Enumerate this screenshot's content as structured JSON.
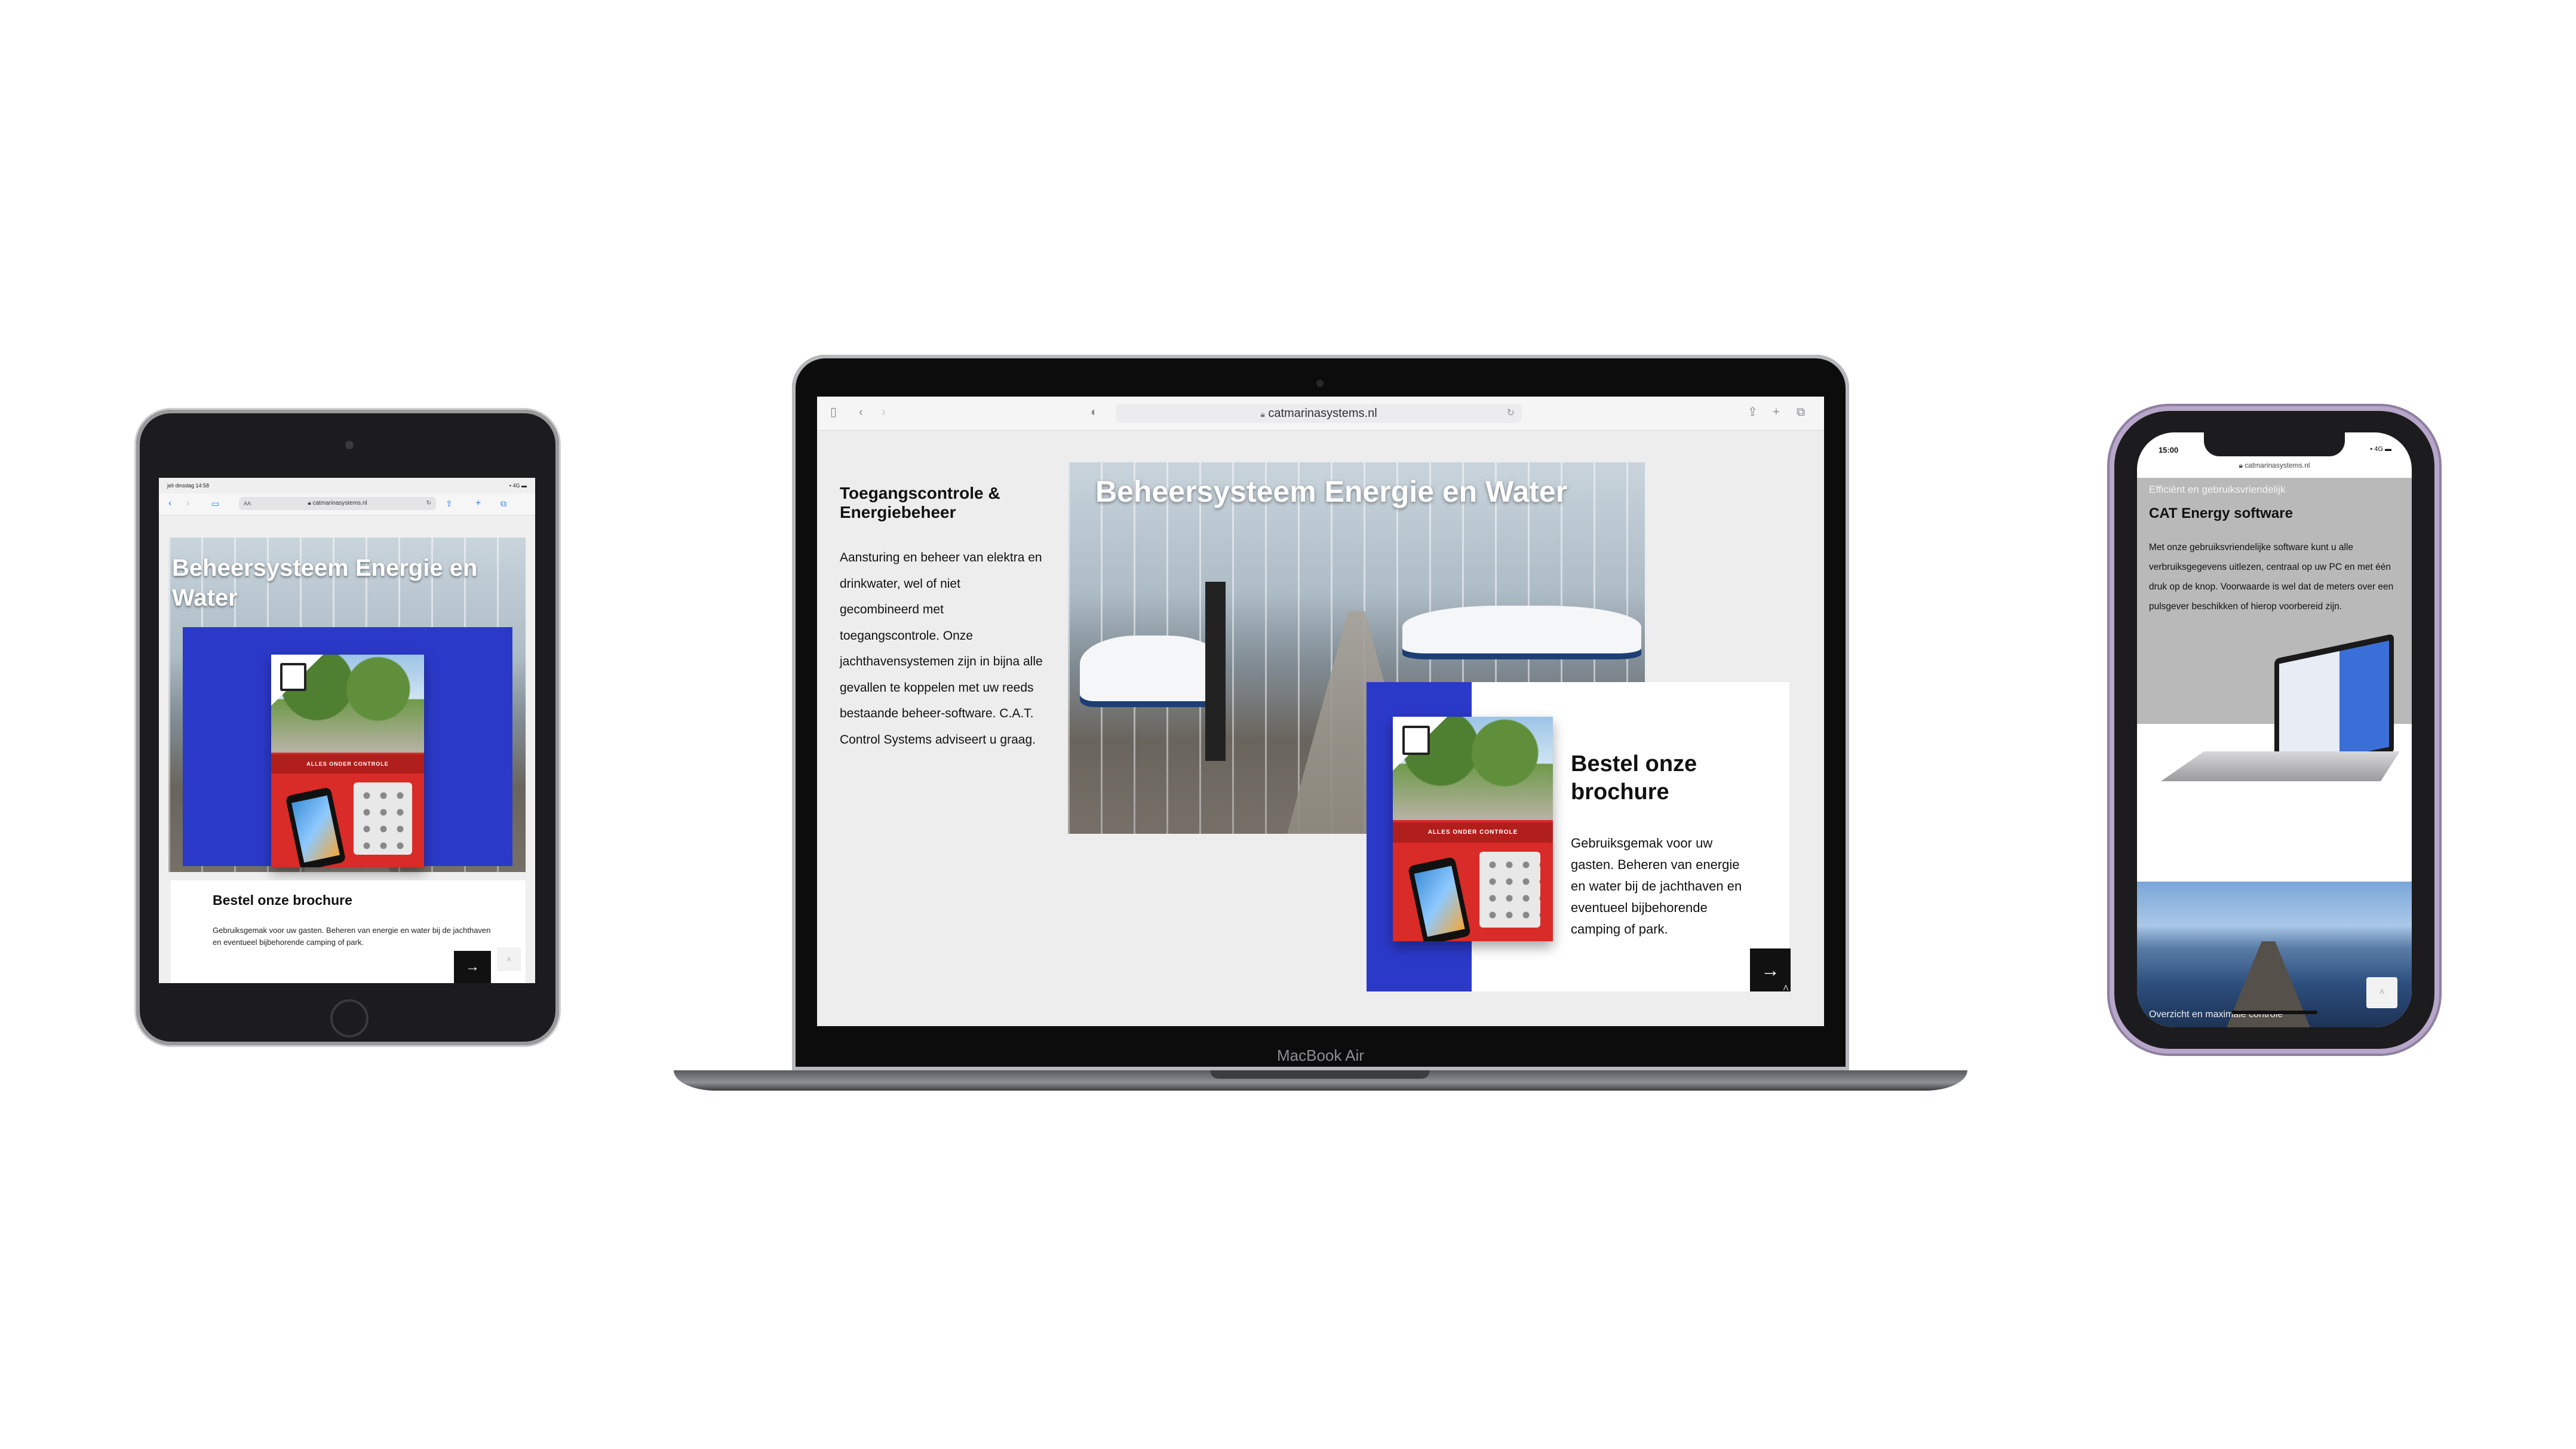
{
  "ipad": {
    "status_time": "jeli dinsdag 14:58",
    "status_right": "▪ 4G ▬",
    "url": "catmarinasystems.nl",
    "url_text_size_label": "AA",
    "hero_title": "Beheersysteem Energie en Water",
    "brochure_band": "ALLES ONDER CONTROLE",
    "card_title": "Bestel onze brochure",
    "card_text": "Gebruiksgemak voor uw gasten. Beheren van energie en water bij de jachthaven en eventueel bijbehorende camping of park.",
    "arrow": "→",
    "totop": "˄"
  },
  "mac": {
    "url": "catmarinasystems.nl",
    "label": "MacBook Air",
    "left_heading": "Toegangscontrole & Energiebeheer",
    "left_body": "Aansturing en beheer van elektra en drinkwater, wel of niet gecombineerd met toegangscontrole. Onze jachthavensystemen zijn in bijna alle gevallen te koppelen met uw reeds bestaande beheer-software. C.A.T. Control Systems adviseert u graag.",
    "hero_title": "Beheersysteem Energie en Water",
    "brochure_band": "ALLES ONDER CONTROLE",
    "card_title": "Bestel onze brochure",
    "card_text": "Gebruiksgemak voor uw gasten. Beheren van energie en water bij de jachthaven en eventueel bijbehorende camping of park.",
    "arrow": "→",
    "totop": "˄"
  },
  "phone": {
    "time": "15:00",
    "signal": "▪ 4G ▬",
    "url": "catmarinasystems.nl",
    "kicker": "Efficiënt en gebruiksvriendelijk",
    "title": "CAT Energy software",
    "body": "Met onze gebruiksvriendelijke software kunt u alle verbruiksgegevens uitlezen, centraal op uw PC en met één druk op de knop. Voorwaarde is wel dat de meters over een pulsgever beschikken of hierop voorbereid zijn.",
    "caption": "Overzicht en maximale controle",
    "totop": "˄"
  },
  "colors": {
    "accent_blue": "#2b39c8",
    "brochure_red": "#d92b27",
    "frame_dark": "#1c1c1e",
    "phone_frame_purple": "#b7a6c9"
  },
  "icons": [
    "back-chevron-icon",
    "forward-chevron-icon",
    "sidebar-icon",
    "share-icon",
    "new-tab-icon",
    "tabs-icon",
    "reload-icon",
    "lock-icon",
    "privacy-icon",
    "arrow-right-icon",
    "scroll-top-icon"
  ]
}
